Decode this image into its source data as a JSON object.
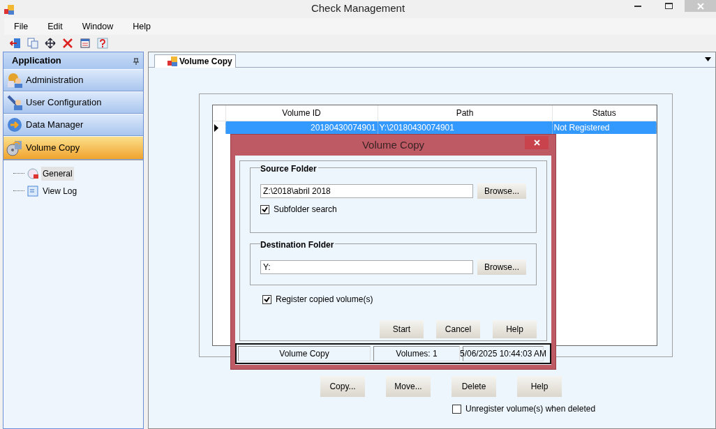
{
  "window": {
    "title": "Check Management"
  },
  "menu": [
    "File",
    "Edit",
    "Window",
    "Help"
  ],
  "sidebar": {
    "title": "Application",
    "items": [
      {
        "label": "Administration",
        "selected": false
      },
      {
        "label": "User Configuration",
        "selected": false
      },
      {
        "label": "Data Manager",
        "selected": false
      },
      {
        "label": "Volume Copy",
        "selected": true
      }
    ],
    "tree": [
      {
        "label": "General",
        "selected": true
      },
      {
        "label": "View Log",
        "selected": false
      }
    ]
  },
  "tabs": [
    {
      "label": "Volume Copy",
      "selected": true
    }
  ],
  "table": {
    "columns": [
      "Volume ID",
      "Path",
      "Status"
    ],
    "rows": [
      {
        "cells": [
          "20180430074901",
          "Y:\\20180430074901",
          "Not Registered"
        ],
        "selected": true
      }
    ]
  },
  "buttons": [
    "Copy...",
    "Move...",
    "Delete",
    "Help"
  ],
  "unregister": {
    "label": "Unregister volume(s) when deleted",
    "checked": false
  },
  "dialog": {
    "title": "Volume Copy",
    "source": {
      "legend": "Source Folder",
      "value": "Z:\\2018\\abril 2018",
      "browse": "Browse...",
      "subfolder": {
        "label": "Subfolder search",
        "checked": true
      }
    },
    "destination": {
      "legend": "Destination Folder",
      "value": "Y:",
      "browse": "Browse..."
    },
    "register": {
      "label": "Register copied volume(s)",
      "checked": true
    },
    "buttons": [
      "Start",
      "Cancel",
      "Help"
    ],
    "status_bar": [
      "Volume Copy",
      "Volumes: 1",
      "5/06/2025 10:44:03 AM"
    ]
  }
}
